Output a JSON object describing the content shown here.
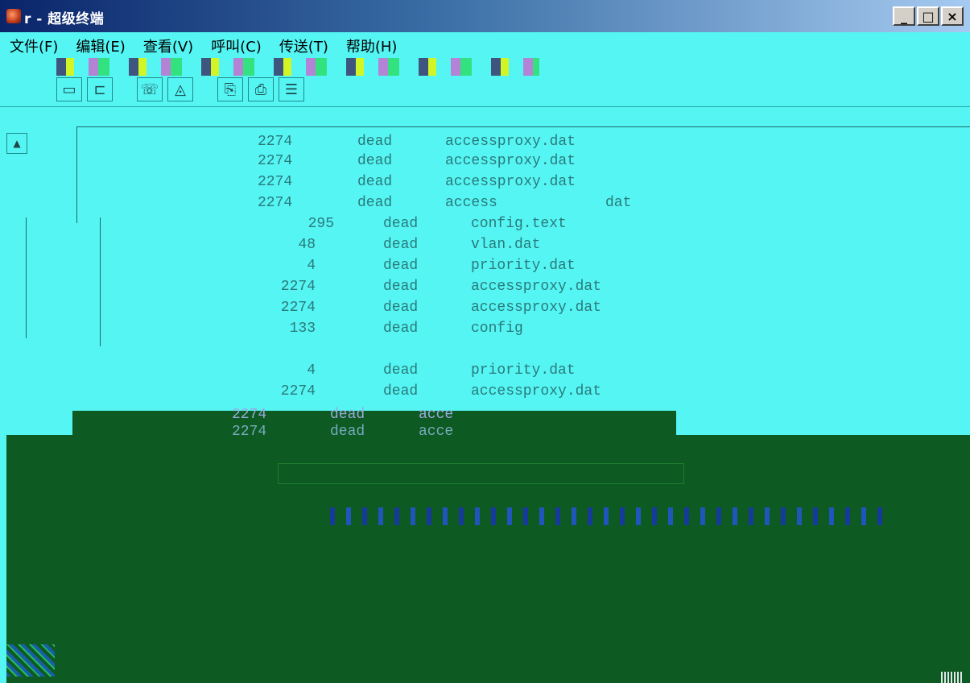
{
  "window": {
    "title": "r - 超级终端",
    "controls": [
      "_",
      "□",
      "×"
    ]
  },
  "menu": {
    "items": [
      "文件(F)",
      "编辑(E)",
      "查看(V)",
      "呼叫(C)",
      "传送(T)",
      "帮助(H)"
    ]
  },
  "toolbar": {
    "icons": [
      "new-icon",
      "open-icon",
      "call-icon",
      "disconnect-icon",
      "send-icon",
      "receive-icon",
      "properties-icon"
    ]
  },
  "terminal": {
    "upper_rows": [
      {
        "size": "2274",
        "status": "dead",
        "file": "accessproxy.dat"
      },
      {
        "size": "2274",
        "status": "dead",
        "file": "accessproxy.dat"
      },
      {
        "size": "2274",
        "status": "dead",
        "file": "accessproxy.dat"
      },
      {
        "size": "2274",
        "status": "dead",
        "file": "access"
      }
    ],
    "upper_last_suffix": "dat",
    "lower_rows": [
      {
        "size": "295",
        "status": "dead",
        "file": "config.text"
      },
      {
        "size": "48",
        "status": "dead",
        "file": "vlan.dat"
      },
      {
        "size": "4",
        "status": "dead",
        "file": "priority.dat"
      },
      {
        "size": "2274",
        "status": "dead",
        "file": "accessproxy.dat"
      },
      {
        "size": "2274",
        "status": "dead",
        "file": "accessproxy.dat"
      },
      {
        "size": "133",
        "status": "dead",
        "file": "config"
      },
      {
        "size": "4",
        "status": "dead",
        "file": "priority.dat"
      },
      {
        "size": "2274",
        "status": "dead",
        "file": "accessproxy.dat"
      }
    ],
    "bottom_rows": [
      {
        "size": "2274",
        "status": "dead",
        "file": "acce"
      },
      {
        "size": "2274",
        "status": "dead",
        "file": "acce"
      }
    ]
  }
}
